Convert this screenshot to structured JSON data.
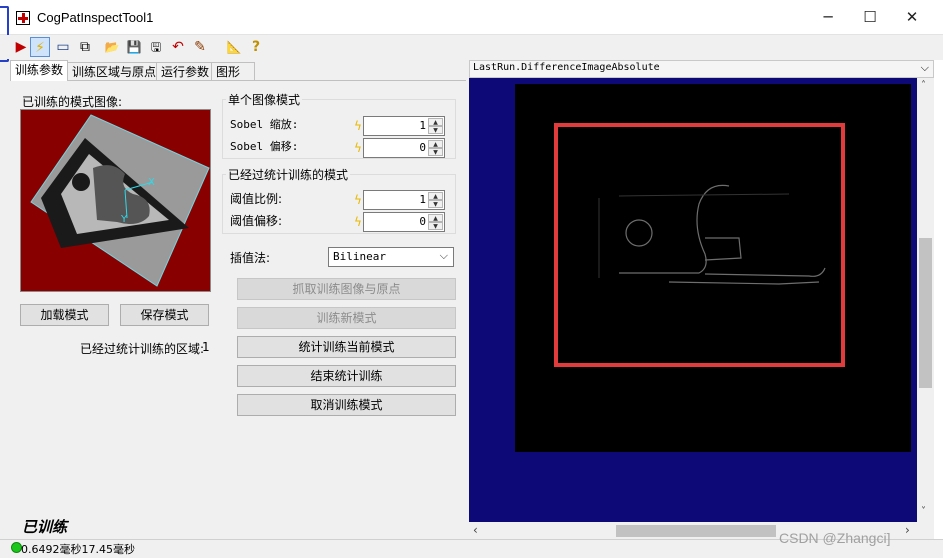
{
  "window": {
    "title": "CogPatInspectTool1",
    "minimize_glyph": "─",
    "maximize_glyph": "☐",
    "close_glyph": "✕"
  },
  "toolbar": {
    "icons": [
      "run-icon",
      "electric-icon",
      "image-view-icon",
      "copy-icon",
      "open-icon",
      "save-icon",
      "save-as-icon",
      "reset-icon",
      "edit-icon",
      "measure-icon",
      "help-icon"
    ],
    "glyphs": [
      "▶",
      "⚡",
      "▭",
      "⧉",
      "📂",
      "💾",
      "🖫",
      "↶",
      "✎",
      "📐",
      "?"
    ]
  },
  "tabs": [
    {
      "label": "训练参数"
    },
    {
      "label": "训练区域与原点"
    },
    {
      "label": "运行参数"
    },
    {
      "label": "图形"
    }
  ],
  "panel": {
    "trained_pattern_label": "已训练的模式图像:",
    "load_pattern_button": "加载模式",
    "save_pattern_button": "保存模式",
    "stat_regions_label": "已经过统计训练的区域:",
    "stat_regions_value": "1",
    "single_image_group": "单个图像模式",
    "sobel_scale_label": "Sobel 缩放:",
    "sobel_scale_value": "1",
    "sobel_offset_label": "Sobel 偏移:",
    "sobel_offset_value": "0",
    "stat_trained_group": "已经过统计训练的模式",
    "threshold_ratio_label": "阈值比例:",
    "threshold_ratio_value": "1",
    "threshold_offset_label": "阈值偏移:",
    "threshold_offset_value": "0",
    "interp_label": "插值法:",
    "interp_value": "Bilinear",
    "grab_button": "抓取训练图像与原点",
    "train_new_button": "训练新模式",
    "stat_train_current_button": "统计训练当前模式",
    "end_stat_button": "结束统计训练",
    "cancel_train_button": "取消训练模式",
    "trained_status": "已训练"
  },
  "statusbar": {
    "timing": "0.6492毫秒17.45毫秒"
  },
  "display": {
    "selector": "LastRun.DifferenceImageAbsolute"
  },
  "watermark": "CSDN @Zhangci]"
}
